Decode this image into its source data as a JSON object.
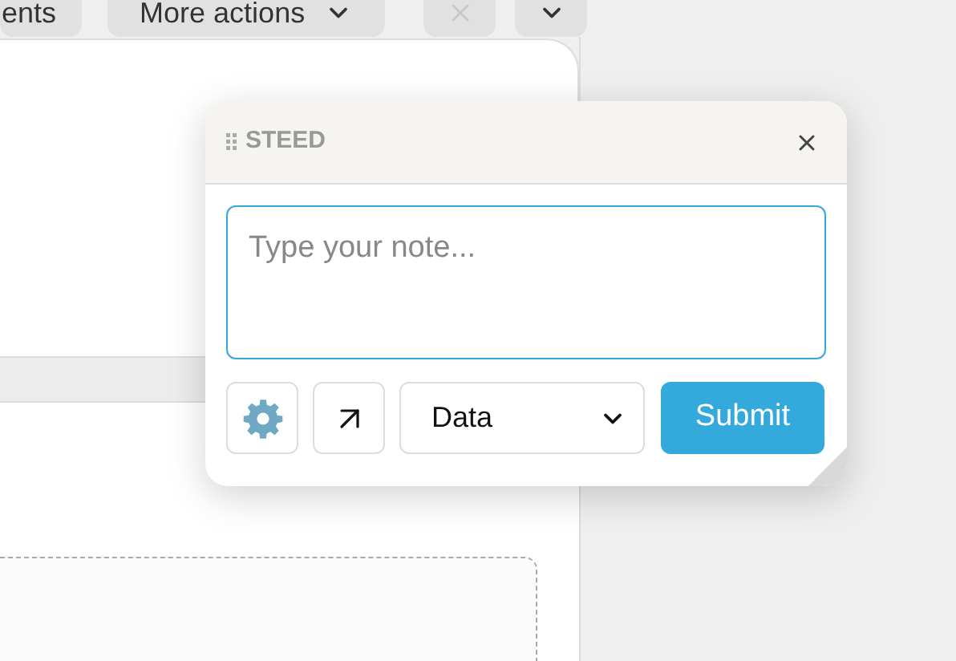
{
  "toolbar": {
    "buttons": [
      {
        "label": "ents"
      },
      {
        "label": "More actions"
      }
    ],
    "close_disabled": true
  },
  "note_popup": {
    "title": "STEED",
    "note": {
      "placeholder": "Type your note..."
    },
    "category": {
      "value": "Data"
    },
    "submit": "Submit"
  }
}
